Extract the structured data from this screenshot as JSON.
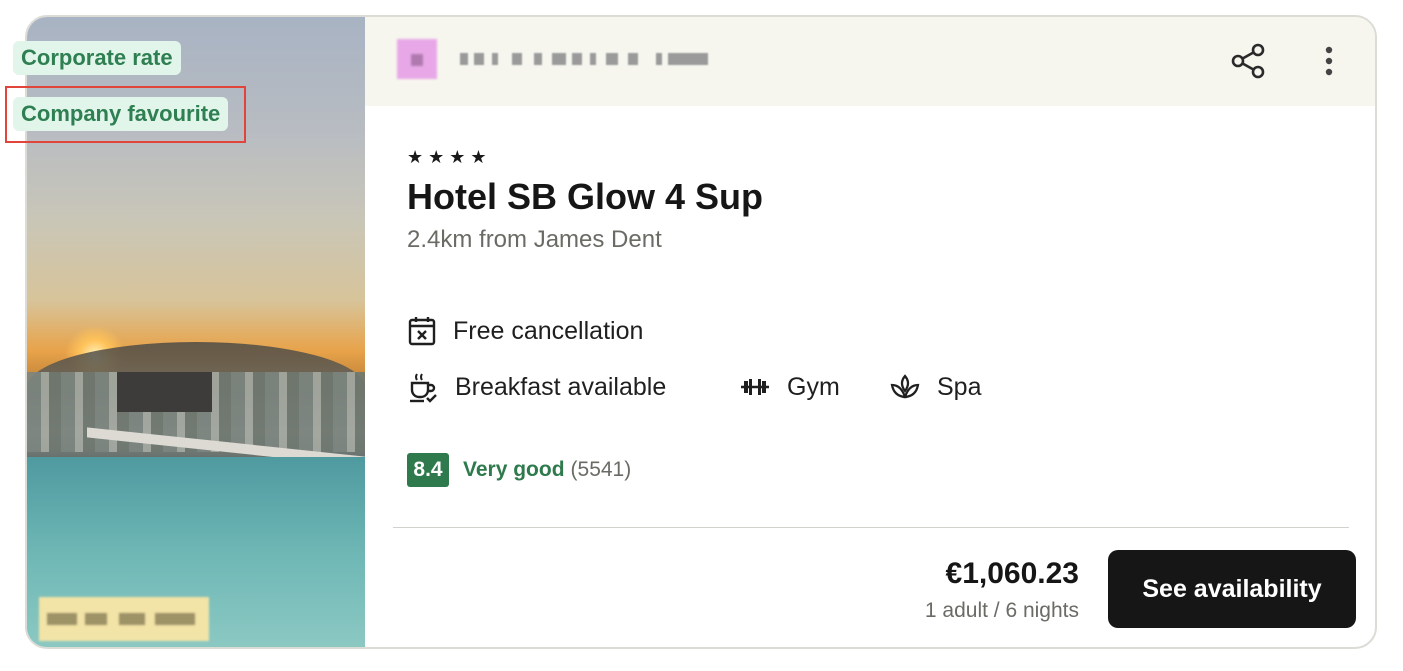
{
  "badges": {
    "corporate_rate": "Corporate rate",
    "company_favourite": "Company favourite"
  },
  "hotel": {
    "stars": "★★★★",
    "name": "Hotel SB Glow 4 Sup",
    "distance": "2.4km from James Dent"
  },
  "features": [
    {
      "icon": "calendar-x-icon",
      "label": "Free cancellation"
    },
    {
      "icon": "coffee-cup-icon",
      "label": "Breakfast available"
    },
    {
      "icon": "dumbbell-icon",
      "label": "Gym"
    },
    {
      "icon": "spa-lotus-icon",
      "label": "Spa"
    }
  ],
  "rating": {
    "score": "8.4",
    "label": "Very good",
    "count": "(5541)"
  },
  "price": {
    "amount": "€1,060.23",
    "detail": "1 adult / 6 nights"
  },
  "actions": {
    "see_availability": "See availability",
    "share_icon": "share-icon",
    "more_icon": "more-vertical-icon"
  },
  "colors": {
    "accent_green": "#2f7a4d",
    "badge_bg": "#e2f5ea",
    "highlight_red": "#e0443a",
    "cta_bg": "#161616",
    "header_bg": "#f6f6ef"
  }
}
